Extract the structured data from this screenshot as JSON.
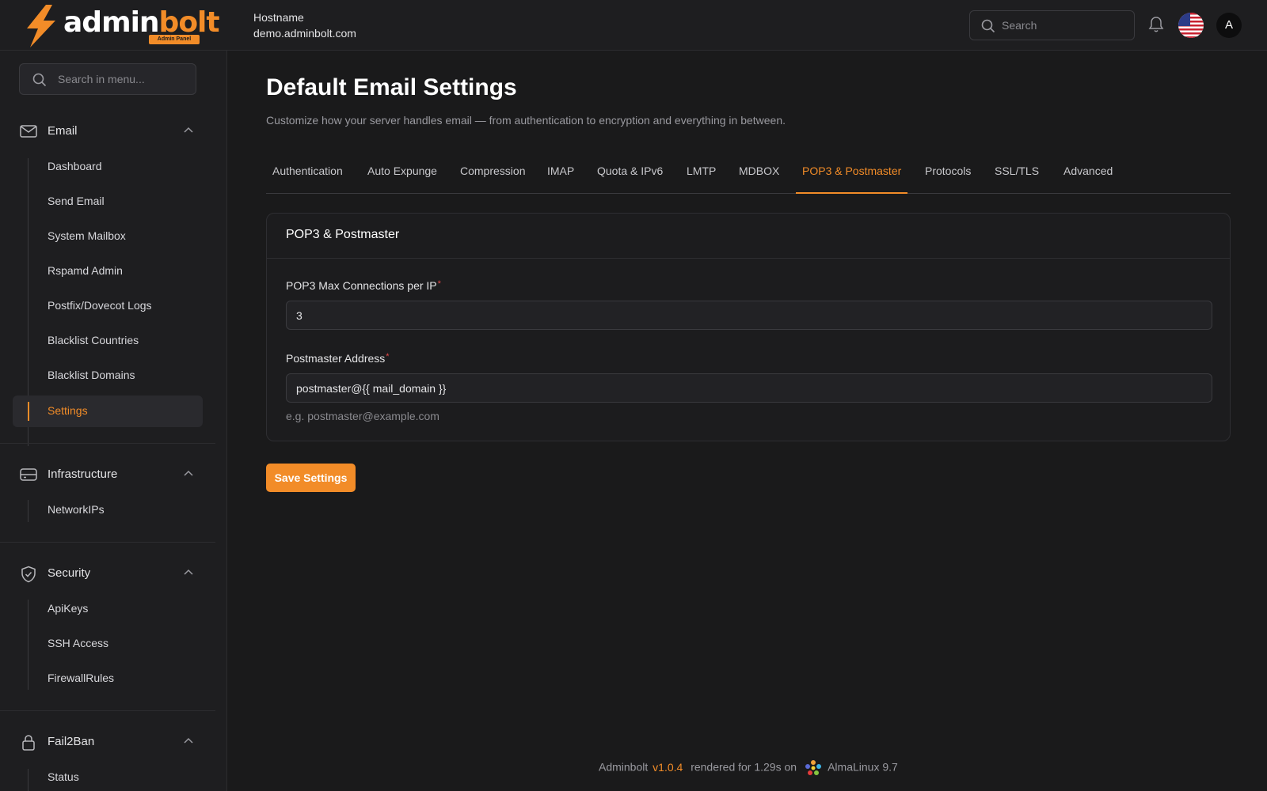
{
  "app": {
    "logo_admin": "admin",
    "logo_bolt": "bolt",
    "logo_badge": "Admin Panel",
    "hostname_label": "Hostname",
    "hostname_value": "demo.adminbolt.com",
    "search_placeholder": "Search",
    "avatar_initial": "A",
    "accent_color": "#f28c28"
  },
  "sidebar": {
    "search_placeholder": "Search in menu...",
    "groups": [
      {
        "label": "Email",
        "icon": "mail-icon",
        "items": [
          {
            "label": "Dashboard"
          },
          {
            "label": "Send Email"
          },
          {
            "label": "System Mailbox"
          },
          {
            "label": "Rspamd Admin"
          },
          {
            "label": "Postfix/Dovecot Logs"
          },
          {
            "label": "Blacklist Countries"
          },
          {
            "label": "Blacklist Domains"
          },
          {
            "label": "Settings",
            "active": true
          }
        ]
      },
      {
        "label": "Infrastructure",
        "icon": "server-icon",
        "items": [
          {
            "label": "NetworkIPs"
          }
        ]
      },
      {
        "label": "Security",
        "icon": "shield-icon",
        "items": [
          {
            "label": "ApiKeys"
          },
          {
            "label": "SSH Access"
          },
          {
            "label": "FirewallRules"
          }
        ]
      },
      {
        "label": "Fail2Ban",
        "icon": "lock-icon",
        "items": [
          {
            "label": "Status"
          }
        ]
      }
    ]
  },
  "main": {
    "title": "Default Email Settings",
    "subtitle": "Customize how your server handles email — from authentication to encryption and everything in between.",
    "tabs": [
      {
        "label": "Authentication"
      },
      {
        "label": "Auto Expunge"
      },
      {
        "label": "Compression"
      },
      {
        "label": "IMAP"
      },
      {
        "label": "Quota & IPv6"
      },
      {
        "label": "LMTP"
      },
      {
        "label": "MDBOX"
      },
      {
        "label": "POP3 & Postmaster",
        "active": true
      },
      {
        "label": "Protocols"
      },
      {
        "label": "SSL/TLS"
      },
      {
        "label": "Advanced"
      }
    ],
    "card": {
      "title": "POP3 & Postmaster",
      "fields": [
        {
          "label": "POP3 Max Connections per IP",
          "required_mark": "*",
          "value": "3"
        },
        {
          "label": "Postmaster Address",
          "required_mark": "*",
          "value": "postmaster@{{ mail_domain }}",
          "hint": "e.g. postmaster@example.com"
        }
      ]
    },
    "save_label": "Save Settings"
  },
  "footer": {
    "prefix": "Adminbolt",
    "version": "v1.0.4",
    "rendered": "rendered for 1.29s on",
    "os": "AlmaLinux 9.7"
  }
}
